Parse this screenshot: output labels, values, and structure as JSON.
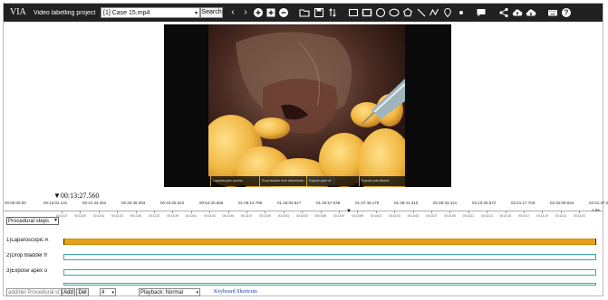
{
  "app": {
    "logo": "VIA",
    "project_name": "Video labelling project",
    "file": "[1] Case 15.mp4",
    "search_label": "Search"
  },
  "toolbar_icons": [
    "chevron-left",
    "chevron-right",
    "add-circle",
    "add-square",
    "remove-circle",
    "folder-open",
    "save",
    "sort",
    "rectangle",
    "extreme-rectangle",
    "circle",
    "ellipse",
    "polygon",
    "line",
    "polyline",
    "point",
    "chat",
    "share",
    "cloud-upload",
    "cloud-download",
    "keyboard",
    "help"
  ],
  "video": {
    "overlay_labels": [
      "Laparoscopic access",
      "Drop bladder from abdominal wall",
      "Expose apex of",
      "Expose and dissect"
    ]
  },
  "timeline": {
    "current_time": "00:13:27.560",
    "major_ticks": [
      "00:00:00.00",
      "00:13:02.131",
      "00:21:44.262",
      "00:32:36.393",
      "00:43:28.524",
      "00:54:20.655",
      "01:05:12.786",
      "01:16:04.917",
      "01:26:57.048",
      "01:37:49.179",
      "01:48:41.310",
      "01:59:33.441",
      "02:10:25.572",
      "02:21:17.703",
      "02:32:09.834",
      "02:51:37.2"
    ],
    "minor_ticks": [
      "00:13:27",
      "00:13:29",
      "00:13:31",
      "00:13:33",
      "00:13:35",
      "00:13:37",
      "00:13:39",
      "00:13:41",
      "00:13:43",
      "00:13:45",
      "00:13:47",
      "00:13:49",
      "00:13:51",
      "00:13:53",
      "00:13:55",
      "00:13:57",
      "00:13:59",
      "00:14:01",
      "00:14:03",
      "00:14:05",
      "00:14:07",
      "00:14:09",
      "00:14:11",
      "00:14:13",
      "00:14:15",
      "00:14:17",
      "00:14:19",
      "00:14:21",
      "00:14:23",
      "00:14:25",
      "00:14:27"
    ],
    "end_label": "1.65",
    "group_select": "Procedural steps",
    "tracks": [
      {
        "label": "1)Laparoscopic A",
        "active": true
      },
      {
        "label": "2)Drop bladder fr",
        "active": false
      },
      {
        "label": "3)Expose apex o",
        "active": false
      },
      {
        "label": "",
        "active": false
      }
    ]
  },
  "controls": {
    "add_placeholder": "add/del Procedural st",
    "add_label": "Add",
    "del_label": "Del",
    "rows_value": "4",
    "playback_value": "Playback: Normal",
    "shortcuts_link": "Keyboard Shortcuts"
  }
}
